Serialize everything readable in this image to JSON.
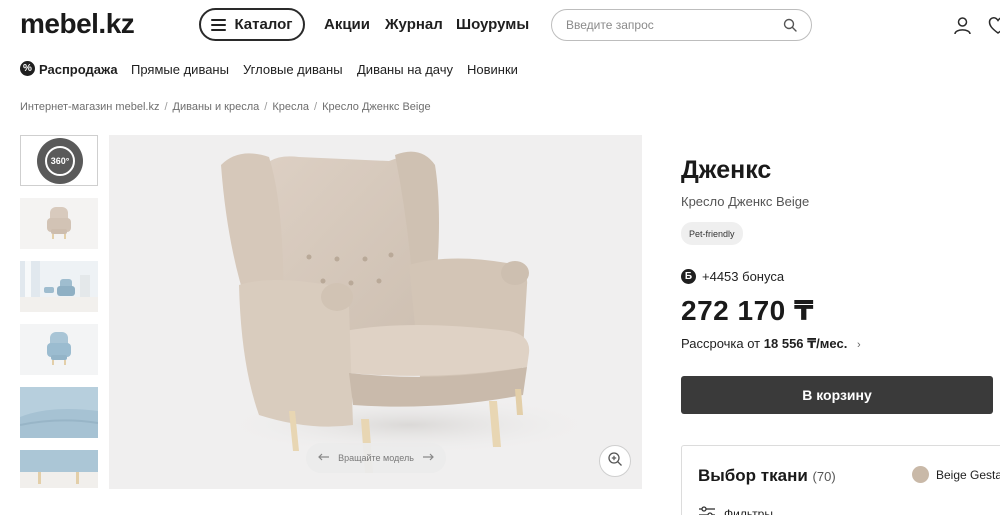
{
  "header": {
    "logo": "mebel.kz",
    "catalog_label": "Каталог",
    "nav": [
      "Акции",
      "Журнал",
      "Шоурумы"
    ],
    "search_placeholder": "Введите запрос"
  },
  "categories": {
    "sale_badge": "%",
    "items": [
      "Распродажа",
      "Прямые диваны",
      "Угловые диваны",
      "Диваны на дачу",
      "Новинки"
    ]
  },
  "breadcrumbs": [
    "Интернет-магазин mebel.kz",
    "Диваны и кресла",
    "Кресла",
    "Кресло Дженкс Beige"
  ],
  "gallery": {
    "thumb_360_label": "360°",
    "rotate_label": "Вращайте модель"
  },
  "product": {
    "title": "Дженкс",
    "subtitle": "Кресло Дженкс Beige",
    "tag": "Pet-friendly",
    "bonus_icon": "Б",
    "bonus": "+4453 бонуса",
    "price": "272 170 ₸",
    "installment_prefix": "Рассрочка от",
    "installment_amount": "18 556 ₸/мес.",
    "cart_label": "В корзину"
  },
  "fabric": {
    "title": "Выбор ткани",
    "count": "(70)",
    "selected_name": "Beige Gesta",
    "swatch_color": "#c9b9a8",
    "filter_label": "Фильтры"
  },
  "colors": {
    "accent_dark": "#3a3a3a",
    "chair": "#d9cbbd",
    "legs": "#e8d6b3"
  }
}
